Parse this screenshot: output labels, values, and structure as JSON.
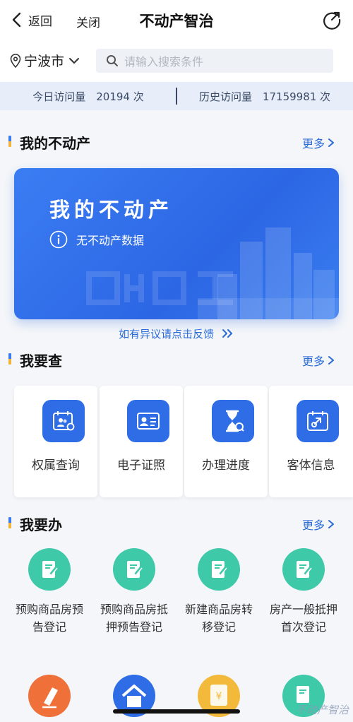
{
  "header": {
    "back_label": "返回",
    "close_label": "关闭",
    "title": "不动产智治"
  },
  "location": {
    "city": "宁波市"
  },
  "search": {
    "placeholder": "请输入搜索条件"
  },
  "stats": {
    "today": "今日访问量　20194 次",
    "history": "历史访问量　17159981 次"
  },
  "my_property": {
    "section_title": "我的不动产",
    "more_label": "更多",
    "card_title": "我的不动产",
    "empty_text": "无不动产数据",
    "dispute_link": "如有异议请点击反馈"
  },
  "query": {
    "section_title": "我要查",
    "more_label": "更多",
    "items": [
      {
        "label": "权属查询",
        "icon": "ownership-query-icon"
      },
      {
        "label": "电子证照",
        "icon": "e-license-icon"
      },
      {
        "label": "办理进度",
        "icon": "progress-hourglass-icon"
      },
      {
        "label": "客体信息",
        "icon": "object-info-icon"
      }
    ]
  },
  "todo": {
    "section_title": "我要办",
    "more_label": "更多",
    "items": [
      {
        "label": "预购商品房预告登记",
        "icon": "document-edit-icon"
      },
      {
        "label": "预购商品房抵押预告登记",
        "icon": "document-edit-icon"
      },
      {
        "label": "新建商品房转移登记",
        "icon": "document-edit-icon"
      },
      {
        "label": "房产一般抵押首次登记",
        "icon": "document-edit-icon"
      }
    ]
  },
  "watermark": "不动产智治",
  "colors": {
    "accent": "#2f6de6",
    "link": "#2a6bd8",
    "teal": "#3ec9a8",
    "orange": "#f0703a",
    "gold": "#f2b93b"
  }
}
